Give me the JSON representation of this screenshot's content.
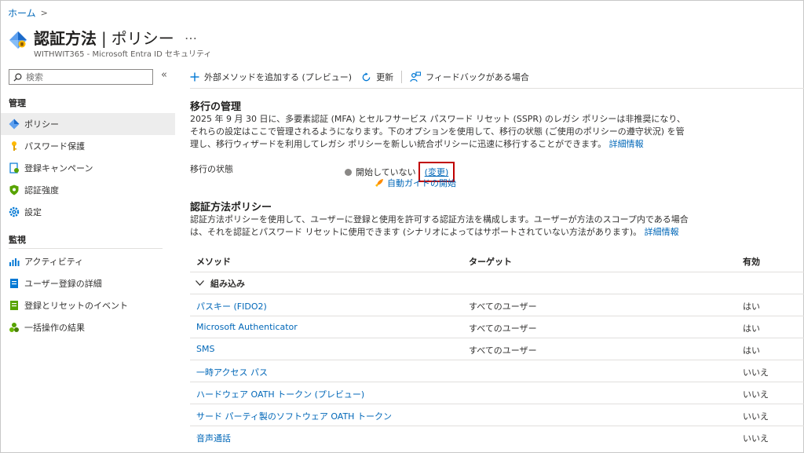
{
  "breadcrumb": {
    "home": "ホーム"
  },
  "header": {
    "title": "認証方法",
    "separator": "|",
    "subtitle": "ポリシー",
    "more": "…",
    "org": "WITHWIT365 - Microsoft Entra ID セキュリティ"
  },
  "sidebar": {
    "search_placeholder": "検索",
    "collapse": "«",
    "groups": [
      {
        "label": "管理",
        "items": [
          {
            "label": "ポリシー",
            "icon": "policy-icon"
          },
          {
            "label": "パスワード保護",
            "icon": "key-icon"
          },
          {
            "label": "登録キャンペーン",
            "icon": "campaign-icon"
          },
          {
            "label": "認証強度",
            "icon": "shield-icon"
          },
          {
            "label": "設定",
            "icon": "gear-icon"
          }
        ]
      },
      {
        "label": "監視",
        "items": [
          {
            "label": "アクティビティ",
            "icon": "activity-icon"
          },
          {
            "label": "ユーザー登録の詳細",
            "icon": "user-details-icon"
          },
          {
            "label": "登録とリセットのイベント",
            "icon": "events-icon"
          },
          {
            "label": "一括操作の結果",
            "icon": "bulk-icon"
          }
        ]
      }
    ]
  },
  "toolbar": {
    "add_external": "外部メソッドを追加する (プレビュー)",
    "refresh": "更新",
    "feedback": "フィードバックがある場合"
  },
  "migration": {
    "heading": "移行の管理",
    "description": "2025 年 9 月 30 日に、多要素認証 (MFA) とセルフサービス パスワード リセット (SSPR) のレガシ ポリシーは非推奨になり、それらの設定はここで管理されるようになります。下のオプションを使用して、移行の状態 (ご使用のポリシーの遵守状況) を管理し、移行ウィザードを利用してレガシ ポリシーを新しい統合ポリシーに迅速に移行することができます。",
    "learn_more": "詳細情報",
    "status_label": "移行の状態",
    "status_value": "開始していない",
    "change": "(変更)",
    "guide": "自動ガイドの開始"
  },
  "policies": {
    "heading": "認証方法ポリシー",
    "description": "認証方法ポリシーを使用して、ユーザーに登録と使用を許可する認証方法を構成します。ユーザーが方法のスコープ内である場合は、それを認証とパスワード リセットに使用できます (シナリオによってはサポートされていない方法があります)。",
    "learn_more": "詳細情報",
    "columns": {
      "method": "メソッド",
      "target": "ターゲット",
      "enabled": "有効"
    },
    "group": "組み込み",
    "rows": [
      {
        "method": "パスキー (FIDO2)",
        "target": "すべてのユーザー",
        "enabled": "はい"
      },
      {
        "method": "Microsoft Authenticator",
        "target": "すべてのユーザー",
        "enabled": "はい"
      },
      {
        "method": "SMS",
        "target": "すべてのユーザー",
        "enabled": "はい"
      },
      {
        "method": "一時アクセス パス",
        "target": "",
        "enabled": "いいえ"
      },
      {
        "method": "ハードウェア OATH トークン (プレビュー)",
        "target": "",
        "enabled": "いいえ"
      },
      {
        "method": "サード パーティ製のソフトウェア OATH トークン",
        "target": "",
        "enabled": "いいえ"
      },
      {
        "method": "音声通話",
        "target": "",
        "enabled": "いいえ"
      }
    ]
  },
  "colors": {
    "link": "#0067b8",
    "highlight": "#c00000",
    "selected": "#ededed"
  }
}
